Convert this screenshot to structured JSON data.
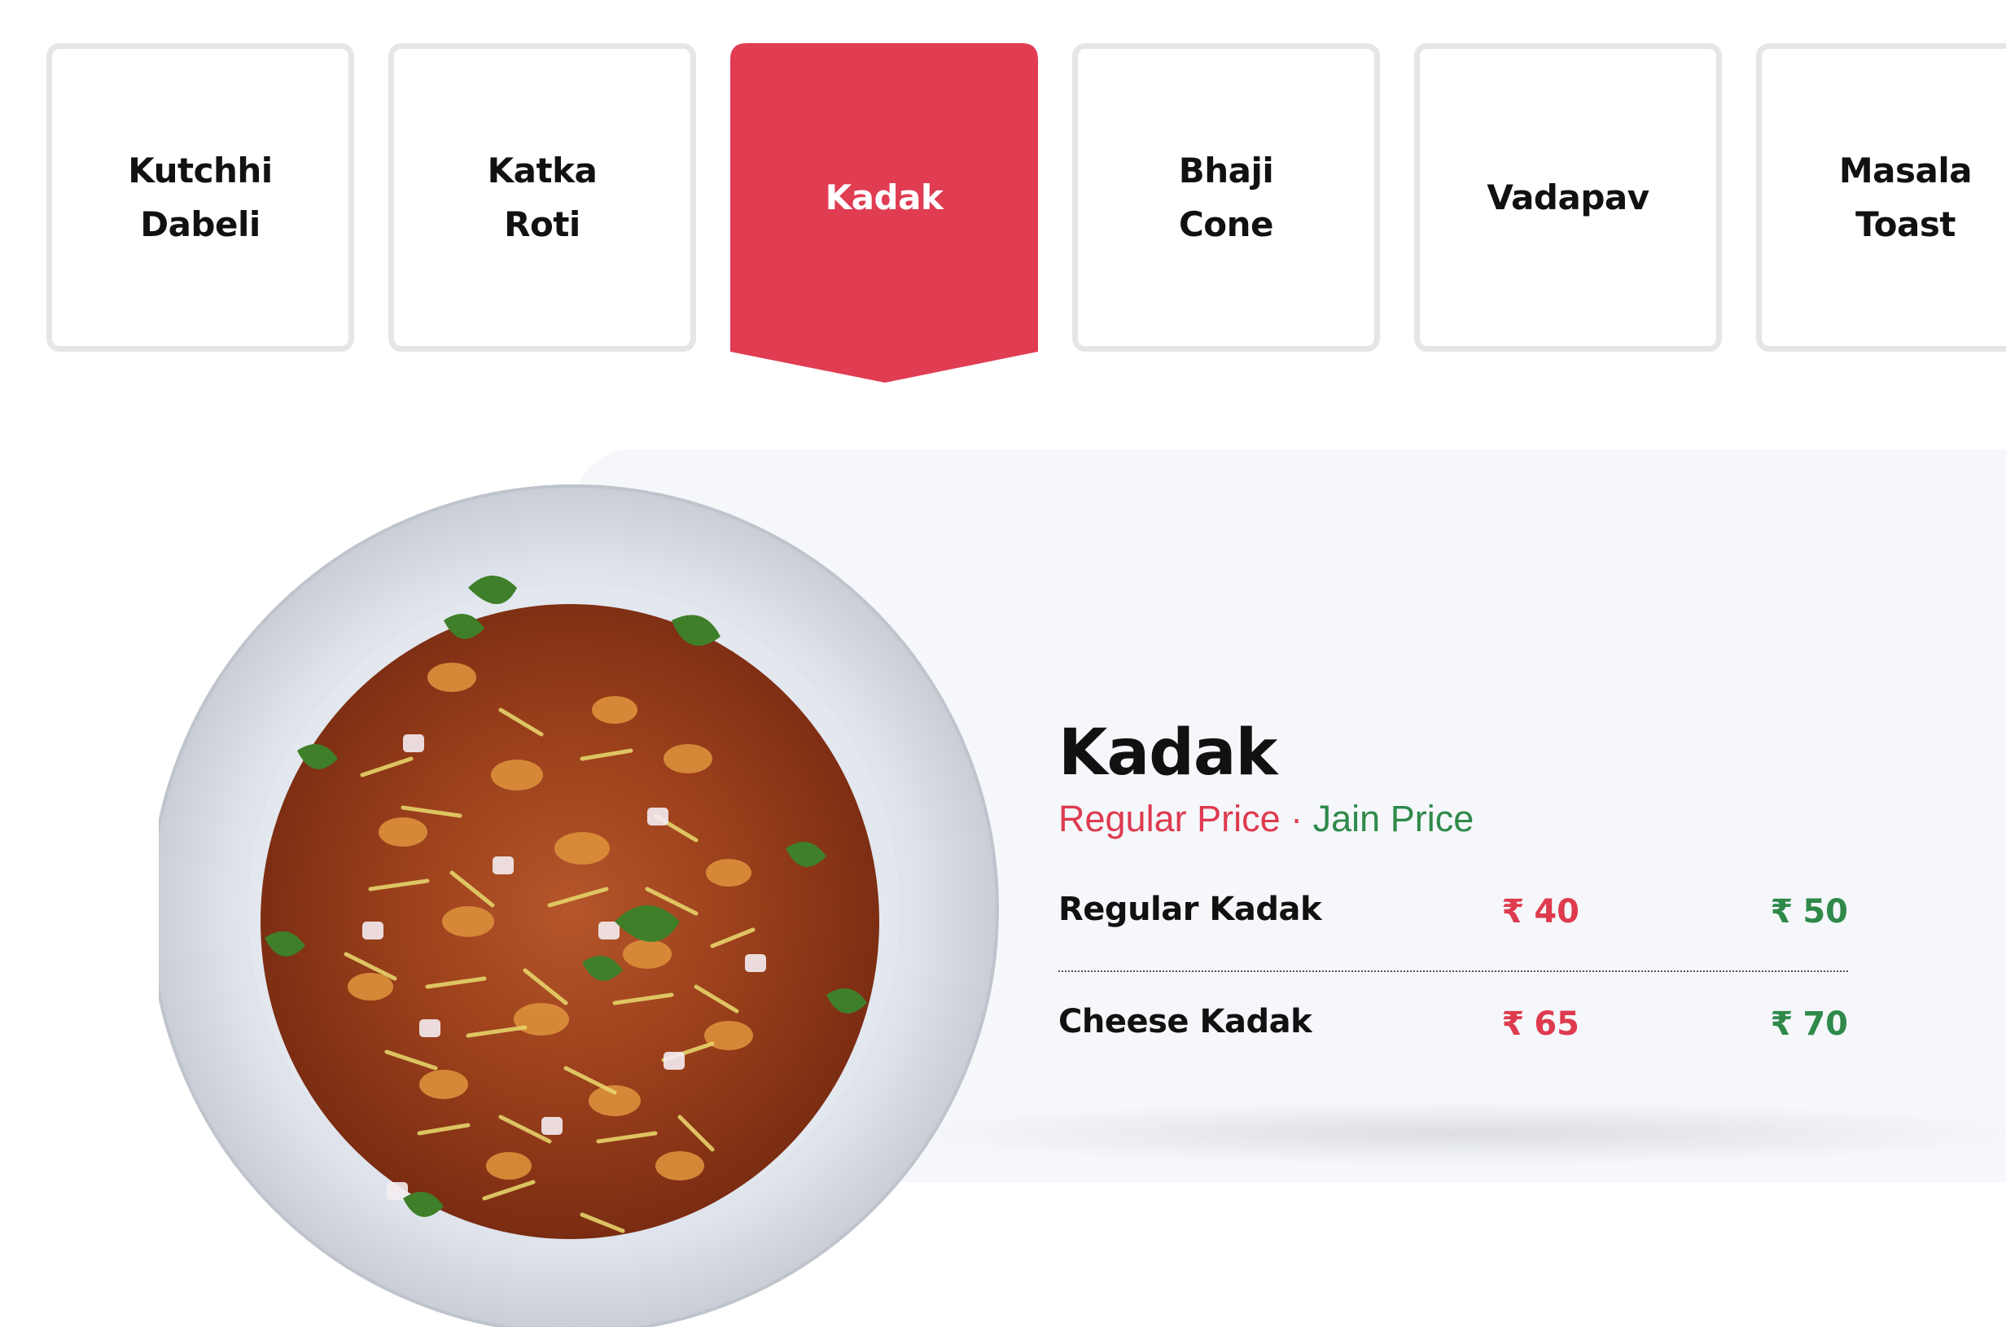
{
  "tabs": [
    {
      "label": "Kutchhi Dabeli",
      "active": false
    },
    {
      "label": "Katka Roti",
      "active": false
    },
    {
      "label": "Kadak",
      "active": true
    },
    {
      "label": "Bhaji Cone",
      "active": false
    },
    {
      "label": "Vadapav",
      "active": false
    },
    {
      "label": "Masala Toast",
      "active": false
    }
  ],
  "item": {
    "title": "Kadak",
    "legend": {
      "regular": "Regular Price",
      "separator": "·",
      "jain": "Jain Price"
    },
    "currency": "₹",
    "variants": [
      {
        "name": "Regular Kadak",
        "regular_price": "40",
        "jain_price": "50"
      },
      {
        "name": "Cheese Kadak",
        "regular_price": "65",
        "jain_price": "70"
      }
    ]
  },
  "colors": {
    "accent": "#e03c52",
    "regular_price": "#de3b4f",
    "jain_price": "#2f8a4a",
    "panel_bg": "#f5f7fb",
    "tab_border": "#e6e6e6"
  },
  "images": {
    "dish": "kadak-dish-photo"
  }
}
